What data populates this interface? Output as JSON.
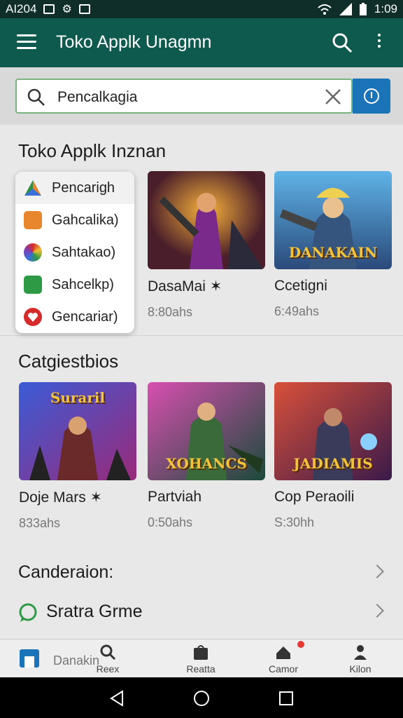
{
  "status_bar": {
    "left_text": "AI204",
    "time": "1:09"
  },
  "app_bar": {
    "title": "Toko Applk Unagmn"
  },
  "search": {
    "value": "Pencalkagia"
  },
  "section1": {
    "title": "Toko Applk Inznan",
    "dropdown": [
      {
        "label": "Pencarigh",
        "icon": "play-triangle-icon",
        "color": "#2f8f46"
      },
      {
        "label": "Gahcalika)",
        "icon": "orange-app-icon",
        "color": "#e8862d"
      },
      {
        "label": "Sahtakao)",
        "icon": "colorful-circle-icon",
        "color": "#7a3fb8"
      },
      {
        "label": "Sahcelkp)",
        "icon": "green-app-icon",
        "color": "#2e9a46"
      },
      {
        "label": "Gencariar)",
        "icon": "red-heart-icon",
        "color": "#d52b2b"
      }
    ],
    "cards": [
      {
        "name": "DasaMai ✶",
        "meta": "8:80ahs",
        "banner": ""
      },
      {
        "name": "Ccetigni",
        "meta": "6:49ahs",
        "banner": "DANAKAIN"
      }
    ]
  },
  "section2": {
    "title": "Catgiestbios",
    "cards": [
      {
        "name": "Doje Mars ✶",
        "meta": "833ahs",
        "banner": "Suraril"
      },
      {
        "name": "Partviah",
        "meta": "0:50ahs",
        "banner": "XOHANCS"
      },
      {
        "name": "Cop Peraoili",
        "meta": "S:30hh",
        "banner": "JADIAMIS"
      }
    ]
  },
  "links": [
    {
      "label": "Canderaion:"
    },
    {
      "label": "Sratra Grme"
    }
  ],
  "bottom_nav": {
    "items": [
      {
        "label": "Danakin"
      },
      {
        "label": "Reex"
      },
      {
        "label": "Reatta"
      },
      {
        "label": "Camor"
      },
      {
        "label": "Kilon"
      }
    ]
  },
  "colors": {
    "app_bar": "#0e5a4f",
    "status_bar": "#0f2e29",
    "accent": "#1b74b8",
    "notification_dot": "#e53935"
  }
}
